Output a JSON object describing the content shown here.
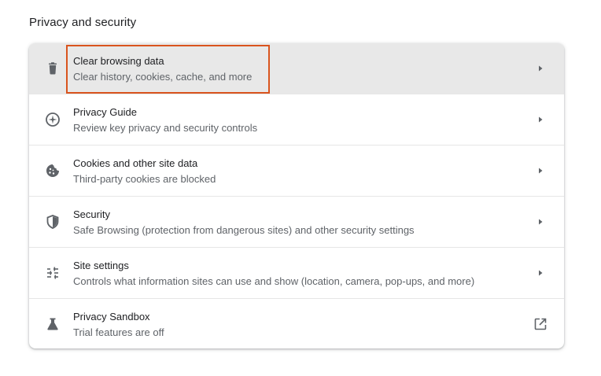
{
  "section": {
    "title": "Privacy and security"
  },
  "items": [
    {
      "label": "Clear browsing data",
      "sublabel": "Clear history, cookies, cache, and more",
      "icon": "trash-icon",
      "action": "chevron-right-icon"
    },
    {
      "label": "Privacy Guide",
      "sublabel": "Review key privacy and security controls",
      "icon": "compass-icon",
      "action": "chevron-right-icon"
    },
    {
      "label": "Cookies and other site data",
      "sublabel": "Third-party cookies are blocked",
      "icon": "cookie-icon",
      "action": "chevron-right-icon"
    },
    {
      "label": "Security",
      "sublabel": "Safe Browsing (protection from dangerous sites) and other security settings",
      "icon": "shield-icon",
      "action": "chevron-right-icon"
    },
    {
      "label": "Site settings",
      "sublabel": "Controls what information sites can use and show (location, camera, pop-ups, and more)",
      "icon": "sliders-icon",
      "action": "chevron-right-icon"
    },
    {
      "label": "Privacy Sandbox",
      "sublabel": "Trial features are off",
      "icon": "flask-icon",
      "action": "external-link-icon"
    }
  ],
  "colors": {
    "highlight": "#d9541e",
    "hover_row": "#e8e8e8",
    "icon": "#5f6368"
  }
}
